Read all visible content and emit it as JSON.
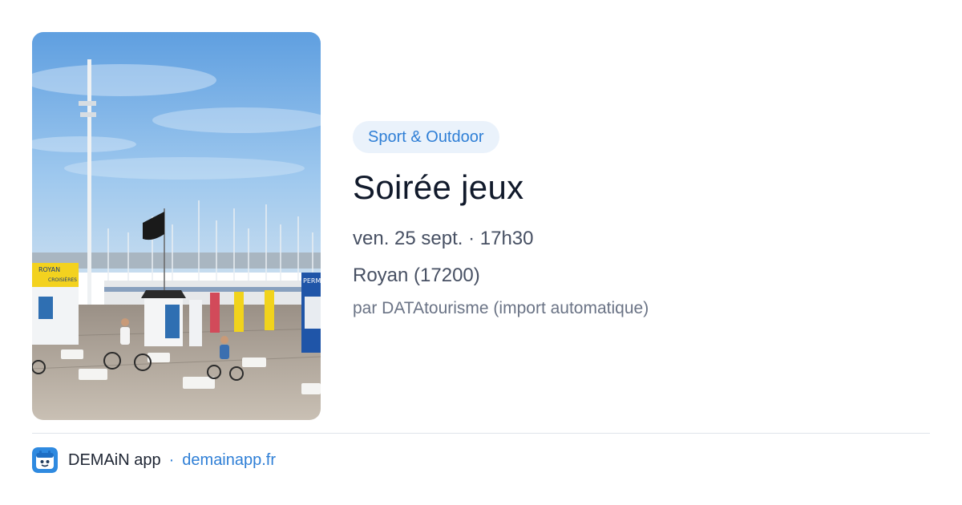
{
  "event": {
    "category": "Sport & Outdoor",
    "title": "Soirée jeux",
    "datetime": "ven. 25 sept. · 17h30",
    "location": "Royan (17200)",
    "source": "par DATAtourisme (import automatique)"
  },
  "photo": {
    "banner_texts": [
      "ROYAN",
      "CROISIÈRES"
    ],
    "kiosk_sign": "PERM"
  },
  "footer": {
    "app_name": "DEMAiN app",
    "separator": "·",
    "domain": "demainapp.fr"
  },
  "colors": {
    "accent": "#2f7fd6",
    "badge_bg": "#eaf2fb",
    "title": "#111a2b",
    "meta": "#475063",
    "muted": "#6a7385"
  }
}
